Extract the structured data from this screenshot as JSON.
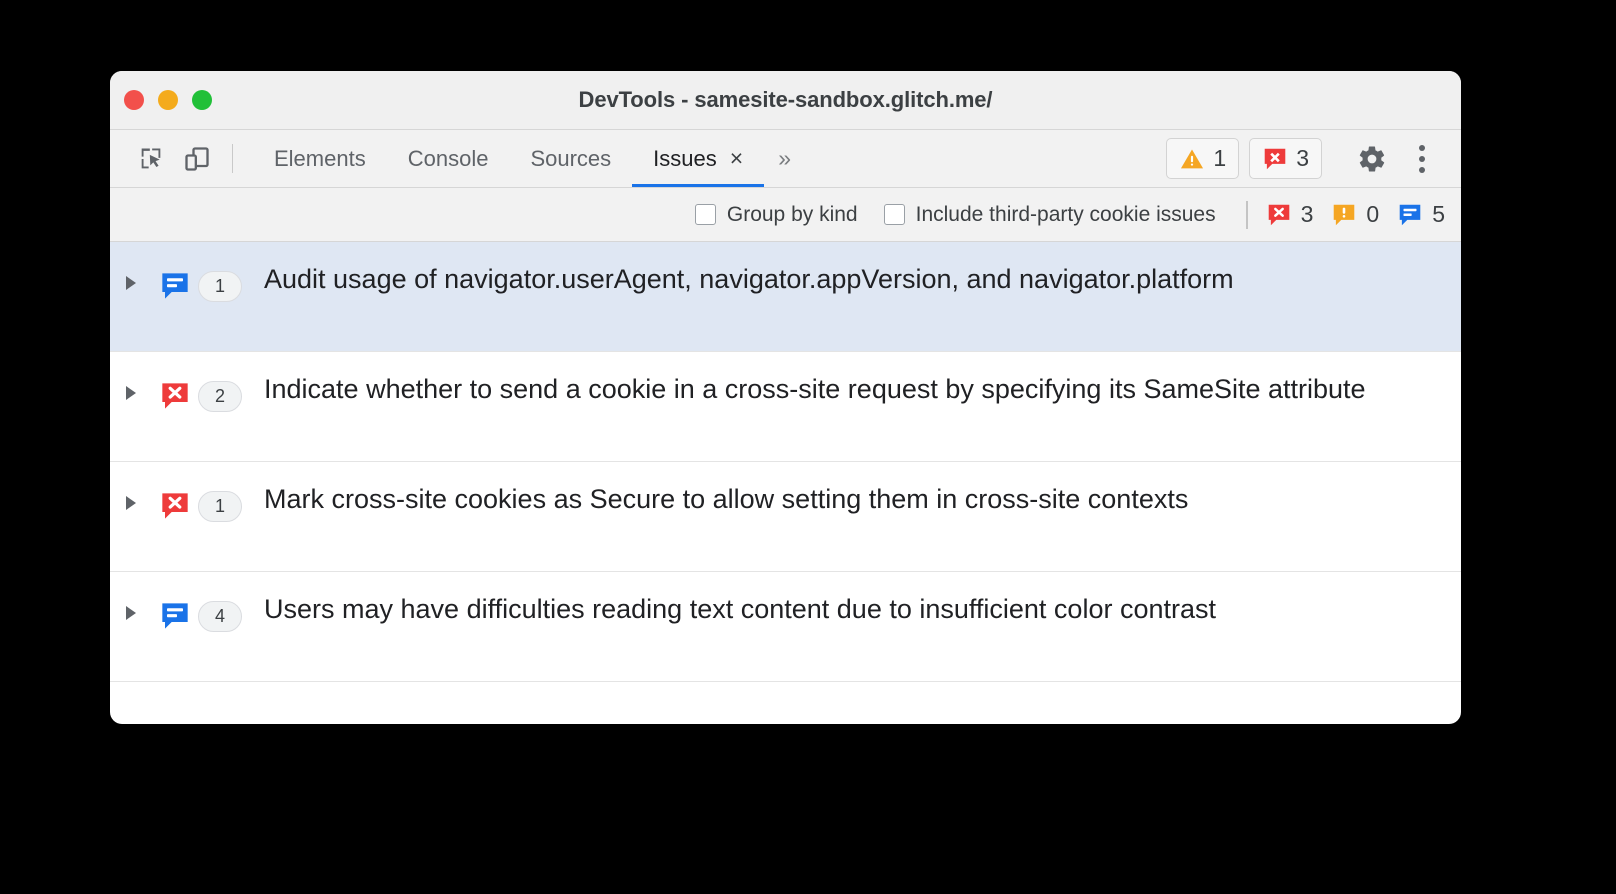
{
  "window": {
    "title": "DevTools - samesite-sandbox.glitch.me/",
    "traffic_lights": [
      "close",
      "minimize",
      "zoom"
    ],
    "colors": {
      "close": "#f2504b",
      "minimize": "#f4ab1c",
      "zoom": "#21c038",
      "accent": "#1a73e8",
      "error": "#ee3b3b",
      "warning": "#f5a623",
      "info": "#1a73e8",
      "selected_row": "#dfe7f3"
    }
  },
  "toolbar": {
    "inspect_icon": "inspect-element-icon",
    "device_icon": "device-toolbar-icon",
    "tabs": [
      {
        "label": "Elements",
        "active": false
      },
      {
        "label": "Console",
        "active": false
      },
      {
        "label": "Sources",
        "active": false
      },
      {
        "label": "Issues",
        "active": true,
        "closeable": true
      }
    ],
    "close_glyph": "×",
    "overflow_glyph": "»",
    "warning_count": "1",
    "error_count": "3",
    "gear_icon": "settings-gear-icon",
    "kebab_icon": "more-options-icon"
  },
  "filterbar": {
    "group_by_kind": {
      "label": "Group by kind",
      "checked": false
    },
    "include_third_party": {
      "label": "Include third-party cookie issues",
      "checked": false
    },
    "counts": {
      "errors": "3",
      "warnings": "0",
      "info": "5"
    }
  },
  "issues": [
    {
      "kind": "info",
      "count": "1",
      "title": "Audit usage of navigator.userAgent, navigator.appVersion, and navigator.platform",
      "selected": true,
      "expanded": false
    },
    {
      "kind": "error",
      "count": "2",
      "title": "Indicate whether to send a cookie in a cross-site request by specifying its SameSite attribute",
      "selected": false,
      "expanded": false
    },
    {
      "kind": "error",
      "count": "1",
      "title": "Mark cross-site cookies as Secure to allow setting them in cross-site contexts",
      "selected": false,
      "expanded": false
    },
    {
      "kind": "info",
      "count": "4",
      "title": "Users may have difficulties reading text content due to insufficient color contrast",
      "selected": false,
      "expanded": false
    }
  ]
}
